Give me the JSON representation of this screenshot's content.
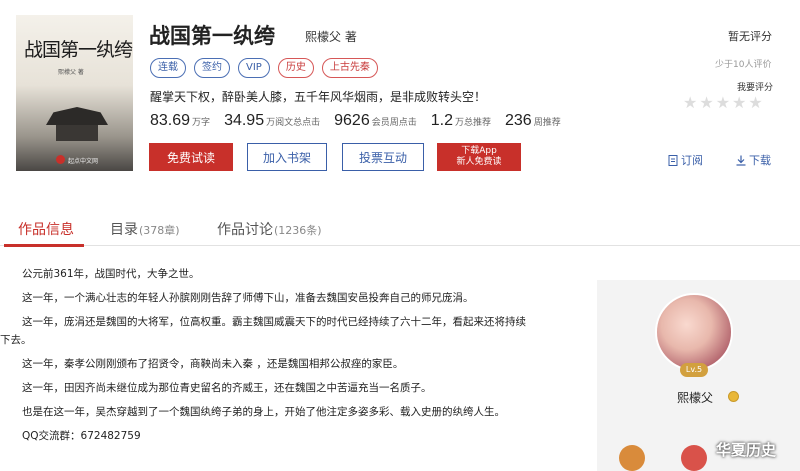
{
  "book": {
    "cover_title": "战国第一纨绔",
    "cover_author": "熙檬父 著",
    "cover_publisher": "起点中文网",
    "title": "战国第一纨绔",
    "author_line": "熙檬父 著",
    "tags": [
      "连载",
      "签约",
      "VIP",
      "历史",
      "上古先秦"
    ],
    "intro": "醒掌天下权，醉卧美人膝，五千年风华烟雨，是非成败转头空！",
    "stats": [
      {
        "value": "83.69",
        "unit": "万字"
      },
      {
        "value": "34.95",
        "unit": "万阅文总点击"
      },
      {
        "value": "9626",
        "unit": "会员周点击"
      },
      {
        "value": "1.2",
        "unit": "万总推荐"
      },
      {
        "value": "236",
        "unit": "周推荐"
      }
    ],
    "buttons": {
      "read": "免费试读",
      "shelf": "加入书架",
      "vote": "投票互动",
      "app_line1": "下载App",
      "app_line2": "新人免费读"
    }
  },
  "rating": {
    "status": "暂无评分",
    "count": "少于10人评价",
    "action": "我要评分",
    "stars": 5
  },
  "links": {
    "subscribe": "订阅",
    "download": "下载"
  },
  "tabs": [
    {
      "label": "作品信息",
      "count": "",
      "active": true
    },
    {
      "label": "目录",
      "count": "(378章)",
      "active": false
    },
    {
      "label": "作品讨论",
      "count": "(1236条)",
      "active": false
    }
  ],
  "description": {
    "lines": [
      "公元前361年，战国时代，大争之世。",
      "这一年，一个满心壮志的年轻人孙膑刚刚告辞了师傅下山，准备去魏国安邑投奔自己的师兄庞涓。",
      "这一年，庞涓还是魏国的大将军，位高权重。霸主魏国威震天下的时代已经持续了六十二年，看起来还将持续",
      "下去。",
      "这一年，秦孝公刚刚颁布了招贤令，商鞅尚未入秦 ，还是魏国相邦公叔痤的家臣。",
      "这一年，田因齐尚未继位成为那位青史留名的齐威王，还在魏国之中苦逼充当一名质子。",
      "也是在这一年，吴杰穿越到了一个魏国纨绔子弟的身上，开始了他注定多姿多彩、载入史册的纨绔人生。",
      "QQ交流群：672482759"
    ]
  },
  "author_panel": {
    "level": "Lv.5",
    "name": "熙檬父"
  },
  "watermark": "华夏历史"
}
